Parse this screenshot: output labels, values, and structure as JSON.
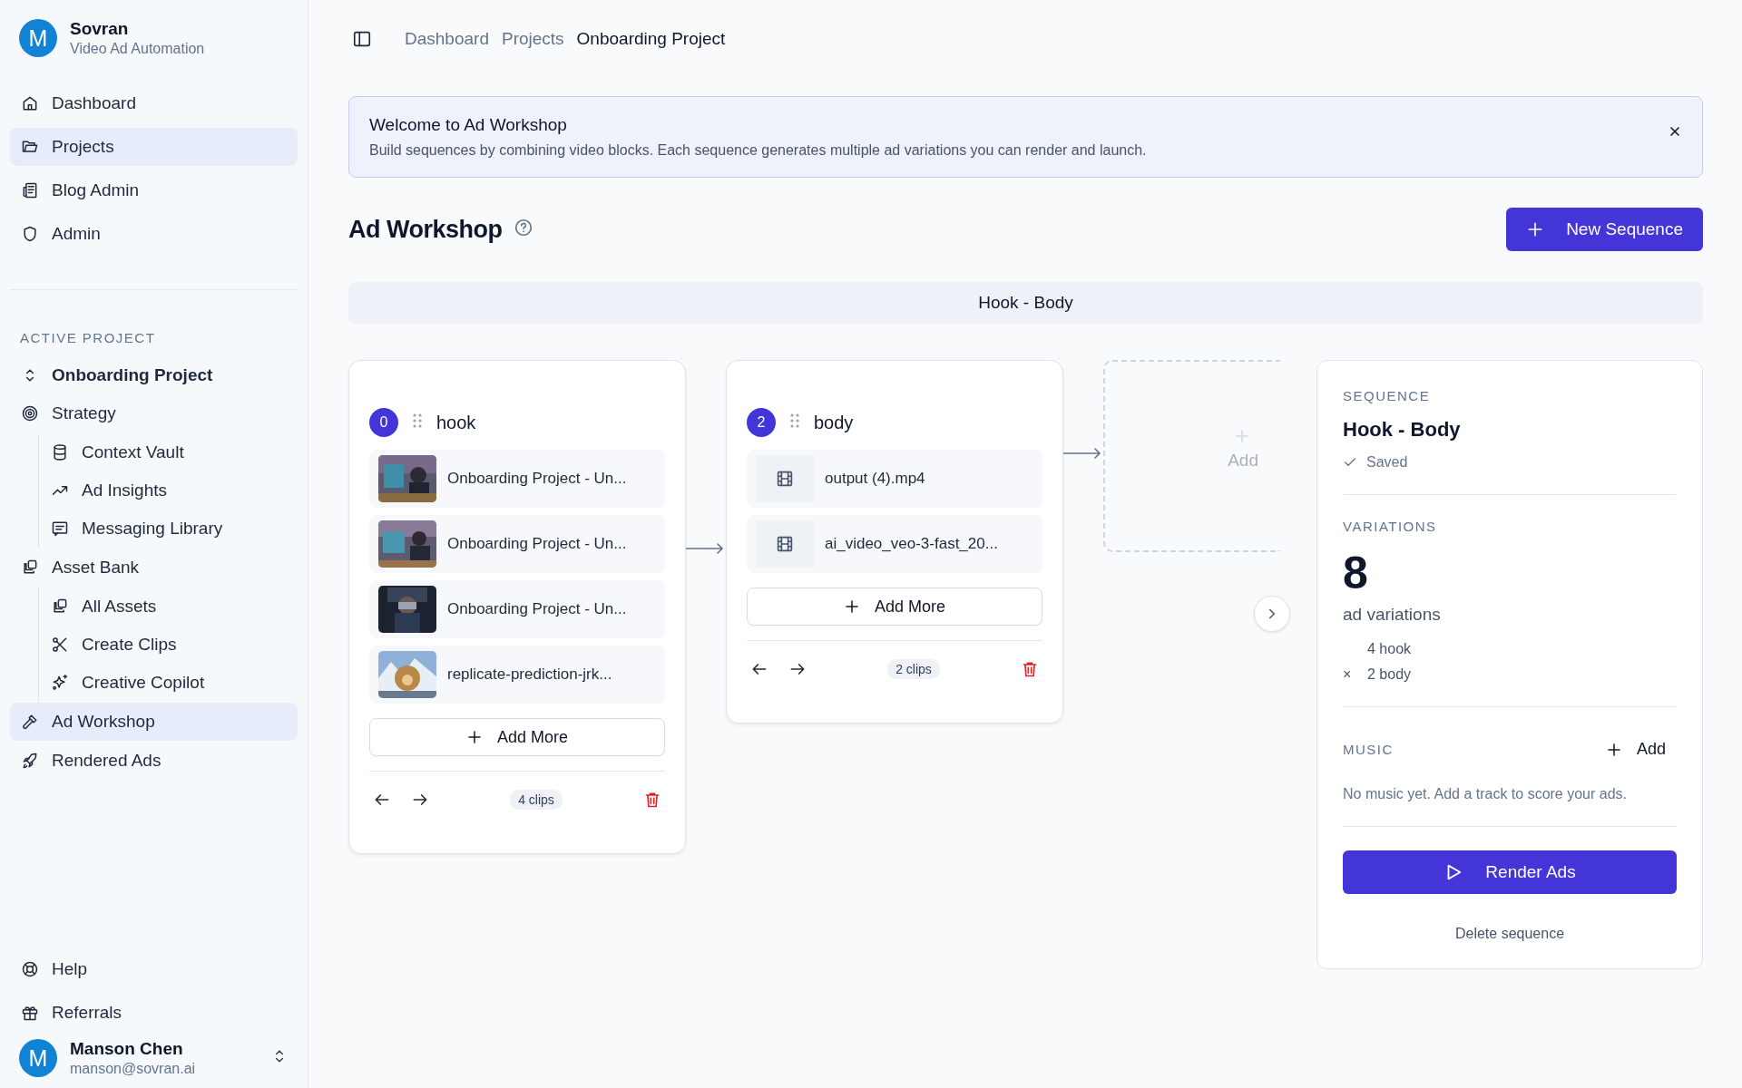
{
  "sidebar": {
    "brand": {
      "avatar": "M",
      "name": "Sovran",
      "subtitle": "Video Ad Automation"
    },
    "nav": [
      {
        "label": "Dashboard",
        "selected": false
      },
      {
        "label": "Projects",
        "selected": true
      },
      {
        "label": "Blog Admin",
        "selected": false
      },
      {
        "label": "Admin",
        "selected": false
      }
    ],
    "active_project": {
      "heading": "ACTIVE PROJECT",
      "name": "Onboarding Project",
      "items": [
        {
          "label": "Strategy",
          "selected": false,
          "children": [
            {
              "label": "Context Vault",
              "selected": false
            },
            {
              "label": "Ad Insights",
              "selected": false
            },
            {
              "label": "Messaging Library",
              "selected": false
            }
          ]
        },
        {
          "label": "Asset Bank",
          "selected": false,
          "children": [
            {
              "label": "All Assets",
              "selected": false
            },
            {
              "label": "Create Clips",
              "selected": false
            },
            {
              "label": "Creative Copilot",
              "selected": false
            }
          ]
        },
        {
          "label": "Ad Workshop",
          "selected": true
        },
        {
          "label": "Rendered Ads",
          "selected": false
        }
      ]
    },
    "footer_nav": [
      {
        "label": "Help"
      },
      {
        "label": "Referrals"
      }
    ],
    "user": {
      "avatar": "M",
      "name": "Manson Chen",
      "email": "manson@sovran.ai"
    }
  },
  "breadcrumbs": [
    {
      "label": "Dashboard",
      "selected": false
    },
    {
      "label": "Projects",
      "selected": false
    },
    {
      "label": "Onboarding Project",
      "selected": true
    }
  ],
  "banner": {
    "title": "Welcome to Ad Workshop",
    "text": "Build sequences by combining video blocks. Each sequence generates multiple ad variations you can render and launch."
  },
  "page_title": "Ad Workshop",
  "new_sequence_button": "New Sequence",
  "sequence_tabs": [
    {
      "label": "Hook - Body",
      "selected": true
    }
  ],
  "blocks": [
    {
      "number": "0",
      "name": "hook",
      "clips": [
        {
          "kind": "thumbnail",
          "name": "Onboarding Project - Un..."
        },
        {
          "kind": "thumbnail",
          "name": "Onboarding Project - Un..."
        },
        {
          "kind": "thumbnail",
          "name": "Onboarding Project - Un..."
        },
        {
          "kind": "thumbnail",
          "name": "replicate-prediction-jrk..."
        }
      ],
      "add_button": "Add More",
      "count": "4 clips"
    },
    {
      "number": "2",
      "name": "body",
      "clips": [
        {
          "kind": "file",
          "name": "output (4).mp4"
        },
        {
          "kind": "file",
          "name": "ai_video_veo-3-fast_20..."
        }
      ],
      "add_button": "Add More",
      "count": "2 clips"
    }
  ],
  "add_block": {
    "label": "Add"
  },
  "panel": {
    "sequence_label": "SEQUENCE",
    "name": "Hook - Body",
    "status": "Saved",
    "variations_label": "VARIATIONS",
    "count": "8",
    "count_caption": "ad variations",
    "factors": [
      {
        "text": "4 hook"
      },
      {
        "operator": "×",
        "text": "2 body"
      }
    ],
    "music_label": "MUSIC",
    "add_music": "Add",
    "music_empty": "No music yet. Add a track to score your ads.",
    "render_button": "Render Ads",
    "delete_link": "Delete sequence"
  }
}
